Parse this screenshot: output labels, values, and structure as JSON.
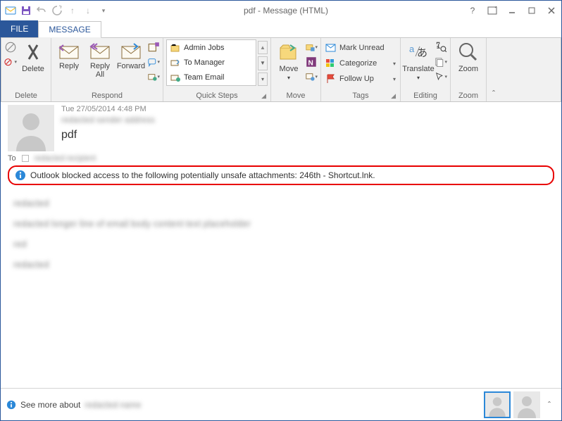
{
  "window": {
    "title": "pdf - Message (HTML)"
  },
  "tabs": {
    "file": "FILE",
    "message": "MESSAGE"
  },
  "ribbon": {
    "delete": {
      "label": "Delete",
      "group": "Delete"
    },
    "respond": {
      "reply": "Reply",
      "replyall": "Reply\nAll",
      "forward": "Forward",
      "group": "Respond"
    },
    "quicksteps": {
      "items": [
        "Admin Jobs",
        "To Manager",
        "Team Email"
      ],
      "group": "Quick Steps"
    },
    "move": {
      "label": "Move",
      "group": "Move"
    },
    "tags": {
      "unread": "Mark Unread",
      "categorize": "Categorize",
      "followup": "Follow Up",
      "group": "Tags"
    },
    "editing": {
      "translate": "Translate",
      "group": "Editing"
    },
    "zoom": {
      "label": "Zoom",
      "group": "Zoom"
    }
  },
  "message": {
    "timestamp": "Tue 27/05/2014 4:48 PM",
    "from": "redacted sender address",
    "subject": "pdf",
    "to_label": "To",
    "to": "redacted recipient",
    "banner": "Outlook blocked access to the following potentially unsafe attachments: 246th - Shortcut.lnk.",
    "body_lines": [
      "redacted",
      "redacted longer line of email body content text placeholder",
      "red",
      "redacted"
    ]
  },
  "bottom": {
    "see_more": "See more about"
  }
}
